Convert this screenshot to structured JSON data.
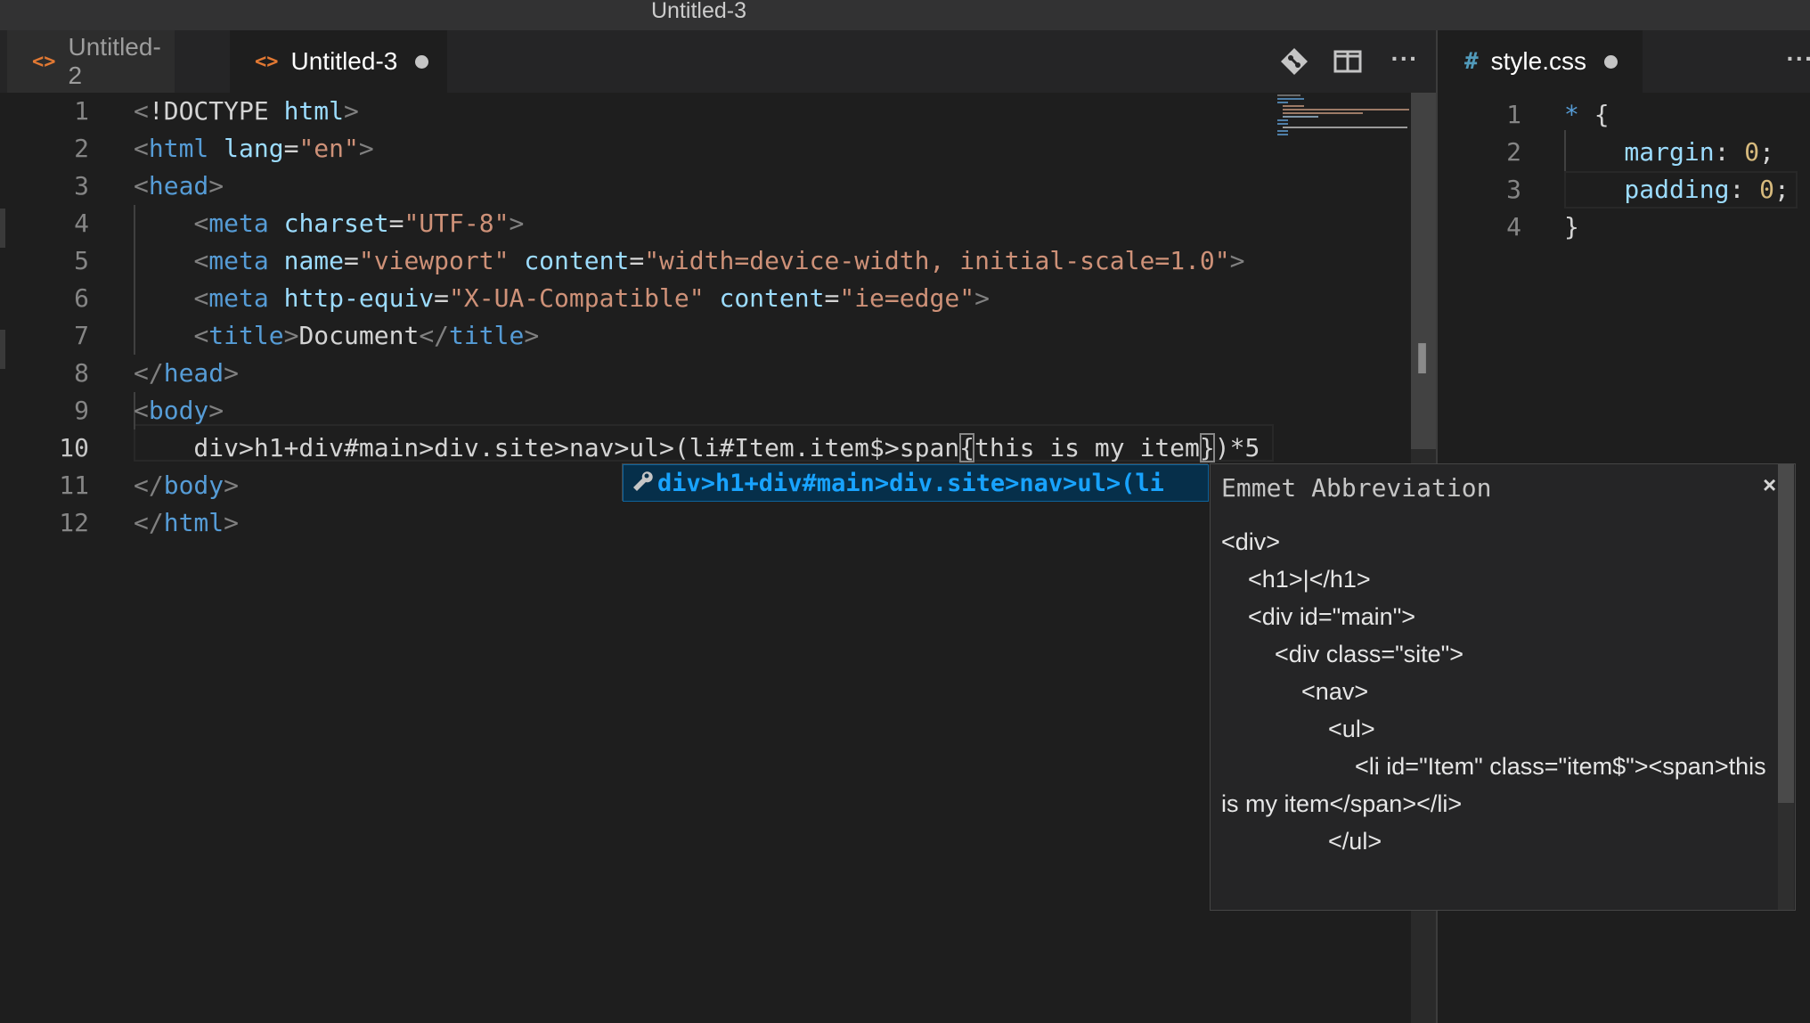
{
  "window": {
    "title": "Untitled-3"
  },
  "left_tabs": [
    {
      "label": "Untitled-2",
      "icon": "html-file-icon",
      "dirty": true,
      "active": false
    },
    {
      "label": "Untitled-3",
      "icon": "html-file-icon",
      "dirty": true,
      "active": true
    }
  ],
  "right_tabs": [
    {
      "label": "style.css",
      "icon": "css-file-icon",
      "dirty": true,
      "active": true
    }
  ],
  "left_editor": {
    "line_numbers": [
      "1",
      "2",
      "3",
      "4",
      "5",
      "6",
      "7",
      "8",
      "9",
      "10",
      "11",
      "12"
    ],
    "lines": [
      "<!DOCTYPE html>",
      "<html lang=\"en\">",
      "<head>",
      "    <meta charset=\"UTF-8\">",
      "    <meta name=\"viewport\" content=\"width=device-width, initial-scale=1.0\">",
      "    <meta http-equiv=\"X-UA-Compatible\" content=\"ie=edge\">",
      "    <title>Document</title>",
      "</head>",
      "<body>",
      "    div>h1+div#main>div.site>nav>ul>(li#Item.item$>span{this is my item})*5",
      "</body>",
      "</html>"
    ]
  },
  "right_editor": {
    "line_numbers": [
      "1",
      "2",
      "3",
      "4"
    ],
    "lines": [
      "* {",
      "    margin: 0;",
      "    padding: 0;",
      "}"
    ]
  },
  "suggestion": {
    "label": "div>h1+div#main>div.site>nav>ul>(li",
    "icon": "wrench-icon"
  },
  "details": {
    "title": "Emmet Abbreviation",
    "close": "×",
    "body": "<div>\n    <h1>|</h1>\n    <div id=\"main\">\n        <div class=\"site\">\n            <nav>\n                <ul>\n                    <li id=\"Item\" class=\"item$\"><span>this is my item</span></li>\n                </ul>"
  },
  "colors": {
    "background": "#1e1e1e",
    "tag": "#569cd6",
    "attribute": "#9cdcfe",
    "string": "#ce9178",
    "suggestion_highlight": "#18a3ff",
    "html_icon": "#e37933",
    "css_icon": "#519aba"
  }
}
